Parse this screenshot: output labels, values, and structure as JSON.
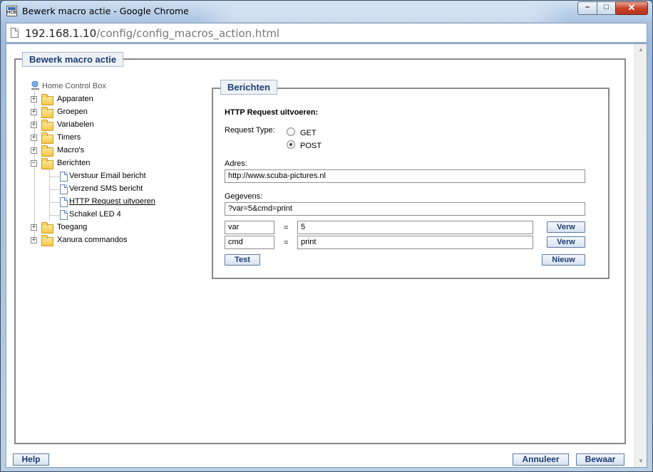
{
  "window": {
    "title": "Bewerk macro actie - Google Chrome",
    "app_icon_text": "HCB",
    "url_host": "192.168.1.10",
    "url_path": "/config/config_macros_action.html"
  },
  "panel": {
    "legend": "Bewerk macro actie"
  },
  "tree": {
    "root": "Home Control Box",
    "folders": [
      "Apparaten",
      "Groepen",
      "Variabelen",
      "Timers",
      "Macro's",
      "Berichten"
    ],
    "berichten_children": [
      "Verstuur Email bericht",
      "Verzend SMS bericht",
      "HTTP Request uitvoeren",
      "Schakel LED 4"
    ],
    "after_folders": [
      "Toegang",
      "Xanura commandos"
    ]
  },
  "form": {
    "legend": "Berichten",
    "heading": "HTTP Request uitvoeren:",
    "request_type_label": "Request Type:",
    "request_types": [
      "GET",
      "POST"
    ],
    "selected_request_type": "POST",
    "address_label": "Adres:",
    "address_value": "http://www.scuba-pictures.nl",
    "data_label": "Gegevens:",
    "data_value": "?var=5&cmd=print",
    "params": [
      {
        "name": "var",
        "eq": "=",
        "value": "5",
        "button": "Verw"
      },
      {
        "name": "cmd",
        "eq": "=",
        "value": "print",
        "button": "Verw"
      }
    ],
    "test_button": "Test",
    "new_button": "Nieuw"
  },
  "footer": {
    "help": "Help",
    "cancel": "Annuleer",
    "save": "Bewaar"
  }
}
